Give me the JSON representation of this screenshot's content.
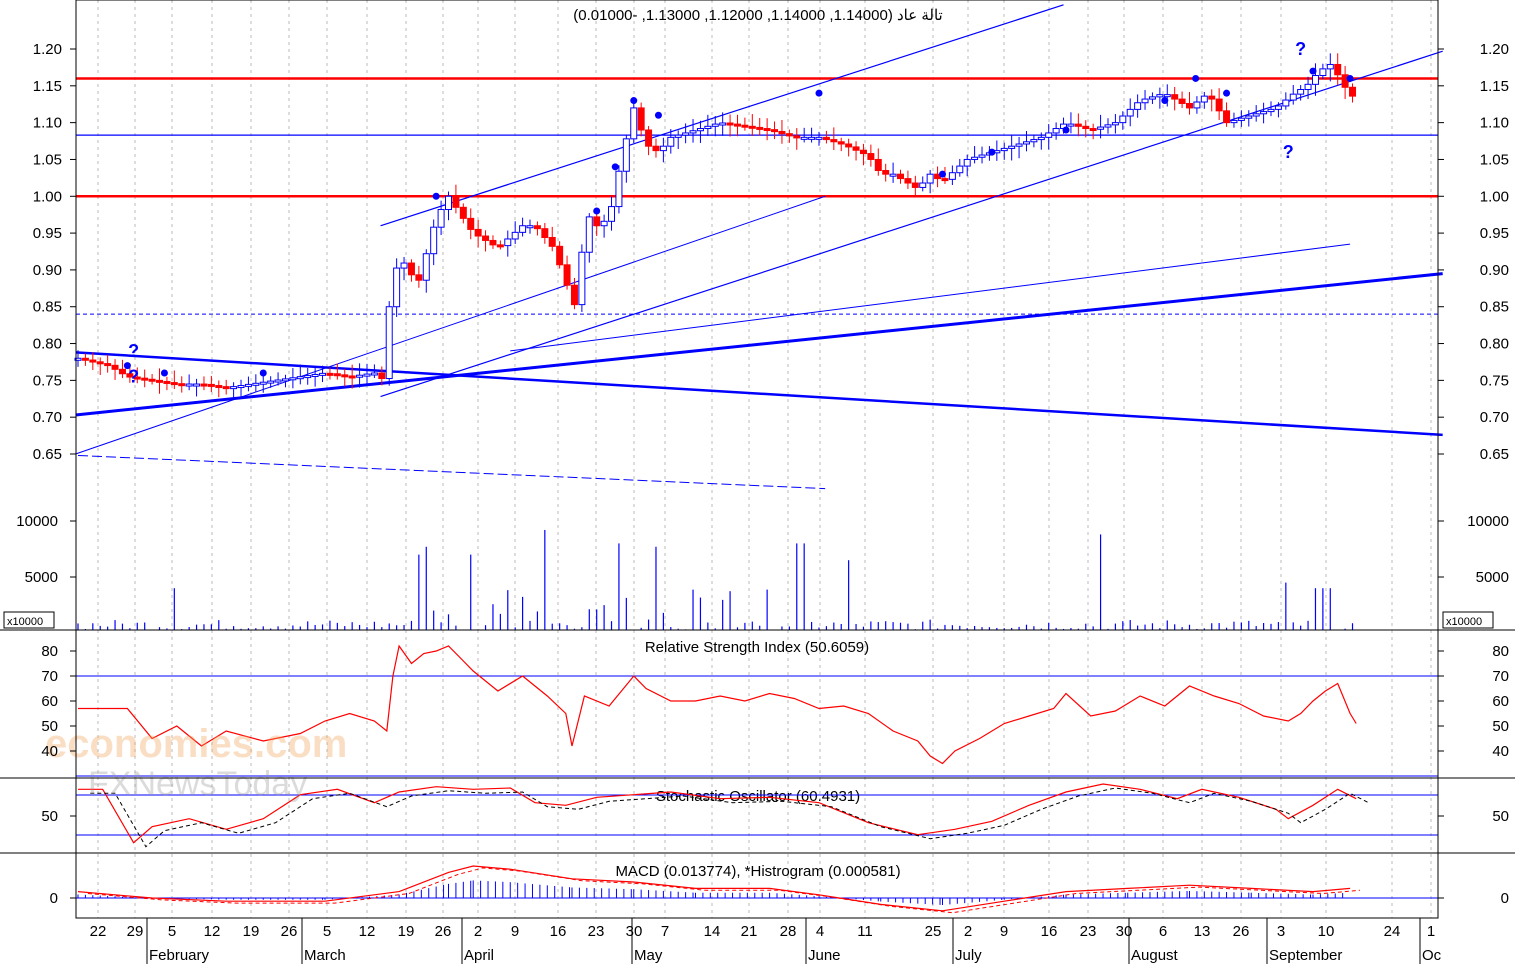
{
  "chart_data": {
    "type": "candlestick",
    "title": "تالة عاد (1.14000, 1.14000, 1.12000, 1.13000, -0.01000)",
    "last_bar": {
      "open": 1.14,
      "high": 1.14,
      "low": 1.12,
      "close": 1.13,
      "change": -0.01
    },
    "price_axis": {
      "ylim": [
        0.61,
        1.24
      ],
      "ticks": [
        "1.20",
        "1.15",
        "1.10",
        "1.05",
        "1.00",
        "0.95",
        "0.90",
        "0.85",
        "0.80",
        "0.75",
        "0.70",
        "0.65"
      ]
    },
    "horizontal_lines": [
      1.16,
      1.083,
      1.0,
      0.84
    ],
    "price_path": [
      [
        0,
        0.78
      ],
      [
        25,
        0.77
      ],
      [
        40,
        0.755
      ],
      [
        60,
        0.75
      ],
      [
        80,
        0.745
      ],
      [
        100,
        0.745
      ],
      [
        120,
        0.74
      ],
      [
        140,
        0.745
      ],
      [
        160,
        0.75
      ],
      [
        180,
        0.755
      ],
      [
        200,
        0.76
      ],
      [
        220,
        0.755
      ],
      [
        240,
        0.76
      ],
      [
        248,
        0.75
      ],
      [
        252,
        0.85
      ],
      [
        260,
        0.92
      ],
      [
        275,
        0.88
      ],
      [
        290,
        0.97
      ],
      [
        300,
        1.0
      ],
      [
        320,
        0.95
      ],
      [
        340,
        0.93
      ],
      [
        360,
        0.96
      ],
      [
        370,
        0.96
      ],
      [
        385,
        0.93
      ],
      [
        398,
        0.87
      ],
      [
        405,
        0.84
      ],
      [
        410,
        0.98
      ],
      [
        420,
        0.96
      ],
      [
        430,
        0.97
      ],
      [
        440,
        1.05
      ],
      [
        450,
        1.12
      ],
      [
        460,
        1.07
      ],
      [
        470,
        1.06
      ],
      [
        480,
        1.08
      ],
      [
        500,
        1.09
      ],
      [
        520,
        1.1
      ],
      [
        540,
        1.095
      ],
      [
        560,
        1.09
      ],
      [
        580,
        1.08
      ],
      [
        600,
        1.08
      ],
      [
        620,
        1.07
      ],
      [
        640,
        1.055
      ],
      [
        650,
        1.03
      ],
      [
        660,
        1.03
      ],
      [
        670,
        1.02
      ],
      [
        680,
        1.01
      ],
      [
        690,
        1.03
      ],
      [
        700,
        1.02
      ],
      [
        720,
        1.05
      ],
      [
        740,
        1.06
      ],
      [
        760,
        1.07
      ],
      [
        780,
        1.08
      ],
      [
        800,
        1.1
      ],
      [
        820,
        1.09
      ],
      [
        840,
        1.1
      ],
      [
        860,
        1.13
      ],
      [
        880,
        1.14
      ],
      [
        900,
        1.12
      ],
      [
        915,
        1.14
      ],
      [
        930,
        1.1
      ],
      [
        950,
        1.11
      ],
      [
        970,
        1.12
      ],
      [
        985,
        1.14
      ],
      [
        995,
        1.15
      ],
      [
        1005,
        1.17
      ],
      [
        1015,
        1.18
      ],
      [
        1025,
        1.15
      ],
      [
        1035,
        1.13
      ]
    ],
    "volume_axis": {
      "ticks": [
        "10000",
        "5000"
      ],
      "multiplier": "x10000"
    },
    "rsi": {
      "title": "Relative Strength Index (50.6059)",
      "value": 50.6059,
      "ticks": [
        "80",
        "70",
        "60",
        "50",
        "40"
      ],
      "levels": [
        70,
        30
      ],
      "path": [
        [
          0,
          57
        ],
        [
          40,
          57
        ],
        [
          60,
          45
        ],
        [
          80,
          50
        ],
        [
          100,
          42
        ],
        [
          120,
          48
        ],
        [
          150,
          44
        ],
        [
          180,
          47
        ],
        [
          200,
          52
        ],
        [
          220,
          55
        ],
        [
          240,
          52
        ],
        [
          250,
          48
        ],
        [
          255,
          70
        ],
        [
          260,
          82
        ],
        [
          270,
          75
        ],
        [
          280,
          79
        ],
        [
          290,
          80
        ],
        [
          300,
          82
        ],
        [
          310,
          77
        ],
        [
          320,
          72
        ],
        [
          340,
          64
        ],
        [
          360,
          70
        ],
        [
          380,
          62
        ],
        [
          395,
          55
        ],
        [
          400,
          42
        ],
        [
          410,
          62
        ],
        [
          430,
          58
        ],
        [
          450,
          70
        ],
        [
          460,
          65
        ],
        [
          480,
          60
        ],
        [
          500,
          60
        ],
        [
          520,
          62
        ],
        [
          540,
          60
        ],
        [
          560,
          63
        ],
        [
          580,
          61
        ],
        [
          600,
          57
        ],
        [
          620,
          58
        ],
        [
          640,
          55
        ],
        [
          660,
          48
        ],
        [
          680,
          44
        ],
        [
          690,
          38
        ],
        [
          700,
          35
        ],
        [
          710,
          40
        ],
        [
          730,
          45
        ],
        [
          750,
          51
        ],
        [
          770,
          54
        ],
        [
          790,
          57
        ],
        [
          800,
          63
        ],
        [
          820,
          54
        ],
        [
          840,
          56
        ],
        [
          860,
          62
        ],
        [
          880,
          58
        ],
        [
          900,
          66
        ],
        [
          920,
          62
        ],
        [
          940,
          59
        ],
        [
          960,
          54
        ],
        [
          980,
          52
        ],
        [
          990,
          55
        ],
        [
          1000,
          60
        ],
        [
          1010,
          64
        ],
        [
          1020,
          67
        ],
        [
          1030,
          55
        ],
        [
          1035,
          51
        ]
      ]
    },
    "stochastic": {
      "title": "Stochastic Oscillator (60.4931)",
      "value": 60.4931,
      "ticks": [
        "50"
      ],
      "levels": [
        80,
        20
      ]
    },
    "macd": {
      "title": "MACD (0.013774), *Histrogram (0.000581)",
      "macd": 0.013774,
      "histogram": 0.000581,
      "ticks": [
        "0"
      ]
    },
    "x_axis": {
      "day_labels": [
        "22",
        "29",
        "5",
        "12",
        "19",
        "26",
        "5",
        "12",
        "19",
        "26",
        "2",
        "9",
        "16",
        "23",
        "30",
        "7",
        "14",
        "21",
        "28",
        "4",
        "11",
        "25",
        "2",
        "9",
        "16",
        "23",
        "30",
        "6",
        "13",
        "26",
        "3",
        "10",
        "24",
        "1"
      ],
      "month_labels": [
        "February",
        "March",
        "April",
        "May",
        "June",
        "July",
        "August",
        "September",
        "Oc"
      ]
    },
    "watermark": [
      "economies.com",
      "FXNewsToday"
    ]
  }
}
